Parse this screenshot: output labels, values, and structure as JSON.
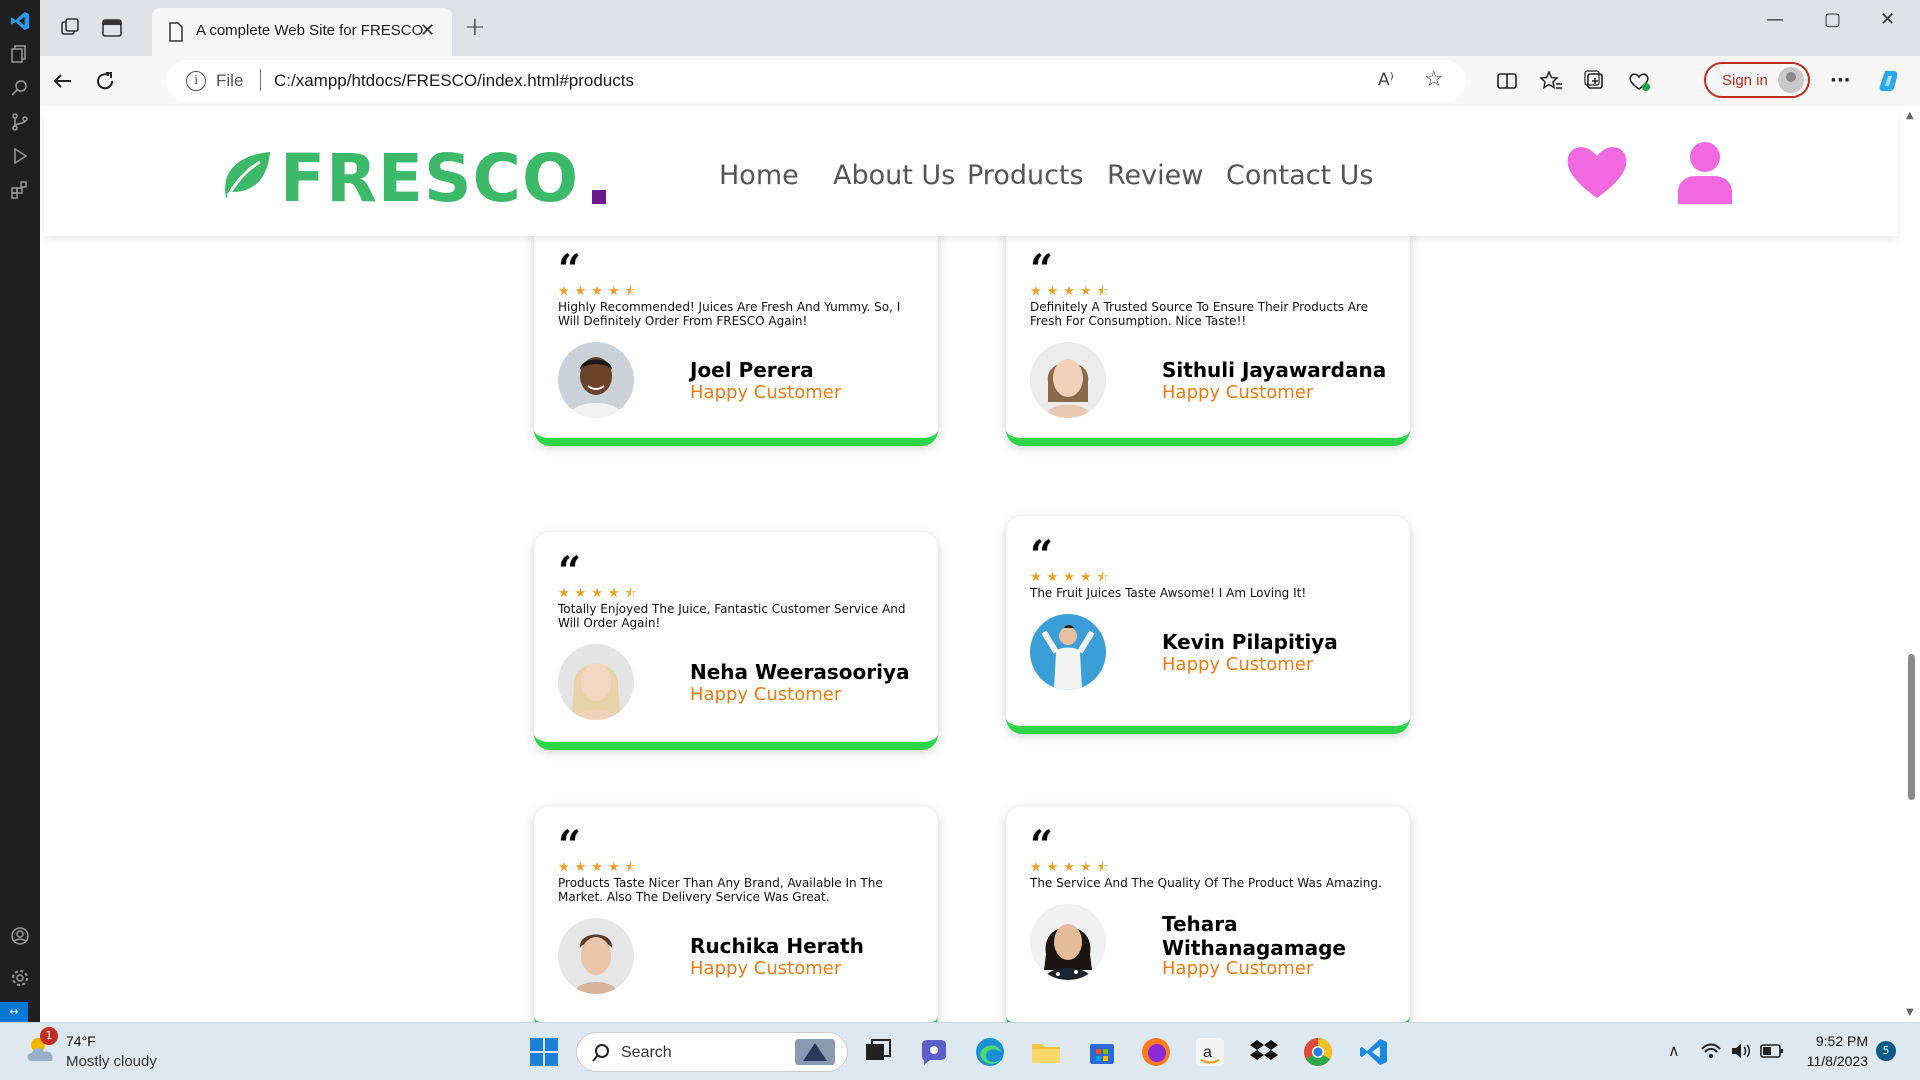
{
  "browser": {
    "tab_title": "A complete Web Site for FRESCO",
    "address_prefix": "File",
    "url": "C:/xampp/htdocs/FRESCO/index.html#products",
    "signin_label": "Sign in",
    "read_aloud_glyph": "A⁾",
    "info_glyph": "i"
  },
  "site": {
    "logo_text": "FRESCO",
    "nav": [
      "Home",
      "About Us",
      "Products",
      "Review",
      "Contact Us"
    ],
    "brand_color": "#3cba6a",
    "accent_color": "#f268e0"
  },
  "reviews": [
    {
      "text": "Highly Recommended! Juices Are Fresh And Yummy. So, I Will Definitely Order From FRESCO Again!",
      "name": "Joel Perera",
      "role": "Happy Customer",
      "rating": 4.5,
      "stars": "★★★★⯪"
    },
    {
      "text": "Definitely A Trusted Source To Ensure Their Products Are Fresh For Consumption. Nice Taste!!",
      "name": "Sithuli Jayawardana",
      "role": "Happy Customer",
      "rating": 4.5,
      "stars": "★★★★⯪"
    },
    {
      "text": "Totally Enjoyed The Juice, Fantastic Customer Service And Will Order Again!",
      "name": "Neha Weerasooriya",
      "role": "Happy Customer",
      "rating": 4.5,
      "stars": "★★★★⯪"
    },
    {
      "text": "The Fruit Juices Taste Awsome! I Am Loving It!",
      "name": "Kevin Pilapitiya",
      "role": "Happy Customer",
      "rating": 4.5,
      "stars": "★★★★⯪"
    },
    {
      "text": "Products Taste Nicer Than Any Brand, Available In The Market. Also The Delivery Service Was Great.",
      "name": "Ruchika Herath",
      "role": "Happy Customer",
      "rating": 4.5,
      "stars": "★★★★⯪"
    },
    {
      "text": "The Service And The Quality Of The Product Was Amazing.",
      "name": "Tehara Withanagamage",
      "role": "Happy Customer",
      "rating": 4.5,
      "stars": "★★★★⯪"
    }
  ],
  "taskbar": {
    "temperature": "74°F",
    "condition": "Mostly cloudy",
    "weather_badge": "1",
    "search_label": "Search",
    "time": "9:52 PM",
    "date": "11/8/2023",
    "notification_count": "5"
  },
  "icons": {
    "quote": "“",
    "tab_close": "✕",
    "new_tab": "+",
    "minimize": "—",
    "maximize": "▢",
    "close": "✕",
    "star": "☆",
    "more": "···",
    "scroll_up": "▲",
    "scroll_down": "▼",
    "tray_up": "∧"
  }
}
